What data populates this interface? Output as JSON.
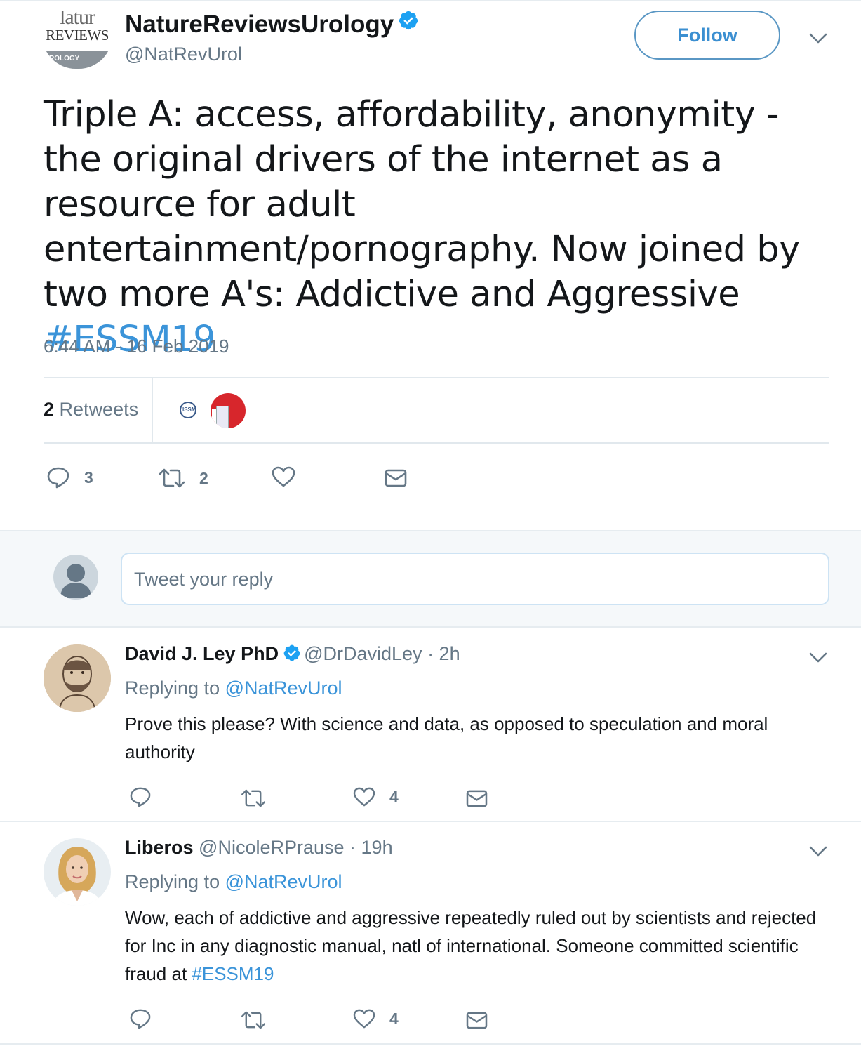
{
  "tweet": {
    "avatar_lines": [
      "latur",
      "REVIEWS",
      "ROLOGY"
    ],
    "author_name": "NatureReviewsUrology",
    "author_handle": "@NatRevUrol",
    "follow_label": "Follow",
    "text_main": "Triple A: access, affordability, anonymity - the original drivers of the internet as a resource for adult entertainment/pornography. Now joined by two more A's: Addictive and Aggressive",
    "hashtag": "#ESSM19",
    "timestamp": "6:44 AM - 16 Feb 2019",
    "retweet_count": "2",
    "retweet_label": "Retweets",
    "retweeter_badge": "ISSM",
    "actions": {
      "replies": "3",
      "retweets": "2",
      "likes": ""
    }
  },
  "compose": {
    "placeholder": "Tweet your reply"
  },
  "replies": [
    {
      "name": "David J. Ley PhD",
      "verified": true,
      "handle": "@DrDavidLey",
      "time": "· 2h",
      "replying_prefix": "Replying to",
      "replying_to": "@NatRevUrol",
      "text": "Prove this please? With science and data, as opposed to speculation and moral authority",
      "hashtag": "",
      "actions": {
        "replies": "",
        "retweets": "",
        "likes": "4"
      }
    },
    {
      "name": "Liberos",
      "verified": false,
      "handle": "@NicoleRPrause",
      "time": "· 19h",
      "replying_prefix": "Replying to",
      "replying_to": "@NatRevUrol",
      "text": "Wow, each of addictive and aggressive repeatedly ruled out by scientists and rejected for Inc in any diagnostic manual, natl of international. Someone committed scientific fraud at",
      "hashtag": "#ESSM19",
      "actions": {
        "replies": "",
        "retweets": "",
        "likes": "4"
      }
    }
  ],
  "colors": {
    "accent": "#3b94d9",
    "text_secondary": "#657786",
    "border": "#e1e8ed",
    "compose_bg": "#f5f8fa"
  },
  "icons": [
    "verified-badge-icon",
    "chevron-down-icon",
    "reply-icon",
    "retweet-icon",
    "like-icon",
    "direct-message-icon",
    "default-avatar-icon"
  ]
}
